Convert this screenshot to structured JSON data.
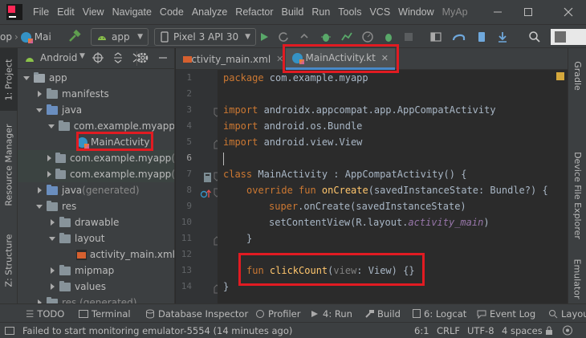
{
  "menubar": {
    "items": [
      {
        "label": "File",
        "mn": "F"
      },
      {
        "label": "Edit",
        "mn": "E"
      },
      {
        "label": "View",
        "mn": "V"
      },
      {
        "label": "Navigate",
        "mn": "N"
      },
      {
        "label": "Code",
        "mn": "C"
      },
      {
        "label": "Analyze",
        "mn": "z"
      },
      {
        "label": "Refactor",
        "mn": "R"
      },
      {
        "label": "Build",
        "mn": "B"
      },
      {
        "label": "Run",
        "mn": "u"
      },
      {
        "label": "Tools",
        "mn": "T"
      },
      {
        "label": "VCS",
        "mn": "S"
      },
      {
        "label": "Window",
        "mn": "W"
      }
    ],
    "title_fragment": "MyAp"
  },
  "toolbar": {
    "breadcrumb_left": "op",
    "breadcrumb_file": "Mai",
    "run_config": "app",
    "device": "Pixel 3 API 30"
  },
  "leftstripe": {
    "project": "1: Project",
    "resource_manager": "Resource Manager",
    "structure": "Z: Structure"
  },
  "project": {
    "view_selector": "Android",
    "tree": [
      {
        "label": "app",
        "level": 0,
        "arrow": "down",
        "icon": "folder-module"
      },
      {
        "label": "manifests",
        "level": 1,
        "arrow": "right",
        "icon": "folder"
      },
      {
        "label": "java",
        "level": 1,
        "arrow": "down",
        "icon": "folder-blue"
      },
      {
        "label": "com.example.myapp",
        "level": 2,
        "arrow": "down",
        "icon": "package"
      },
      {
        "label": "MainActivity",
        "level": 3,
        "arrow": "none",
        "icon": "kotlin-file"
      },
      {
        "label": "com.example.myapp",
        "suffix": " (",
        "level": 2,
        "arrow": "right",
        "icon": "package",
        "hl": true
      },
      {
        "label": "com.example.myapp",
        "suffix": " (",
        "level": 2,
        "arrow": "right",
        "icon": "package",
        "hl": true
      },
      {
        "label": "java",
        "suffix": " (generated)",
        "level": 1,
        "arrow": "right",
        "icon": "folder-blue"
      },
      {
        "label": "res",
        "level": 1,
        "arrow": "down",
        "icon": "folder"
      },
      {
        "label": "drawable",
        "level": 2,
        "arrow": "right",
        "icon": "folder"
      },
      {
        "label": "layout",
        "level": 2,
        "arrow": "down",
        "icon": "folder"
      },
      {
        "label": "activity_main.xml",
        "level": 3,
        "arrow": "none",
        "icon": "xml-file"
      },
      {
        "label": "mipmap",
        "level": 2,
        "arrow": "right",
        "icon": "folder"
      },
      {
        "label": "values",
        "level": 2,
        "arrow": "right",
        "icon": "folder"
      },
      {
        "label": "res (generated)",
        "level": 1,
        "arrow": "right",
        "icon": "folder"
      }
    ]
  },
  "editor": {
    "tabs": [
      {
        "label": "activity_main.xml",
        "active": false
      },
      {
        "label": "MainActivity.kt",
        "active": true
      }
    ],
    "line_numbers": [
      "1",
      "2",
      "3",
      "4",
      "5",
      "6",
      "7",
      "8",
      "9",
      "10",
      "11",
      "12",
      "13",
      "14"
    ],
    "code": {
      "l1_kw": "package",
      "l1_rest": " com.example.myapp",
      "l3_kw": "import",
      "l3_rest": " androidx.appcompat.app.AppCompatActivity",
      "l4_kw": "import",
      "l4_rest": " android.os.Bundle",
      "l5_kw": "import",
      "l5_rest": " android.view.View",
      "l7_kw": "class",
      "l7_rest": " MainActivity : AppCompatActivity() {",
      "l8_kw1": "override",
      "l8_kw2": " fun ",
      "l8_fn": "onCreate",
      "l8_rest": "(savedInstanceState: Bundle?) {",
      "l9_kw": "super",
      "l9_rest": ".onCreate(savedInstanceState)",
      "l10_a": "setContentView(R.layout.",
      "l10_b": "activity_main",
      "l10_c": ")",
      "l11": "}",
      "l13_kw": "fun ",
      "l13_fn": "clickCount",
      "l13_p1": "(",
      "l13_pv": "view",
      "l13_p2": ": View) {}",
      "l14": "}"
    }
  },
  "rightstripe": {
    "gradle": "Gradle",
    "device_file_explorer": "Device File Explorer",
    "emulator": "Emulator"
  },
  "bottombar": {
    "todo": "TODO",
    "terminal": "Terminal",
    "database": "Database Inspector",
    "profiler": "Profiler",
    "run": "4: Run",
    "build": "Build",
    "logcat": "6: Logcat",
    "event_log": "Event Log",
    "layout": "Layou"
  },
  "statusbar": {
    "message": "Failed to start monitoring emulator-5554 (14 minutes ago)",
    "position": "6:1",
    "line_sep": "CRLF",
    "encoding": "UTF-8",
    "indent": "4 spaces"
  },
  "colors": {
    "highlight_box": "#e11b22",
    "keyword": "#cc7832",
    "function": "#ffc66d"
  }
}
